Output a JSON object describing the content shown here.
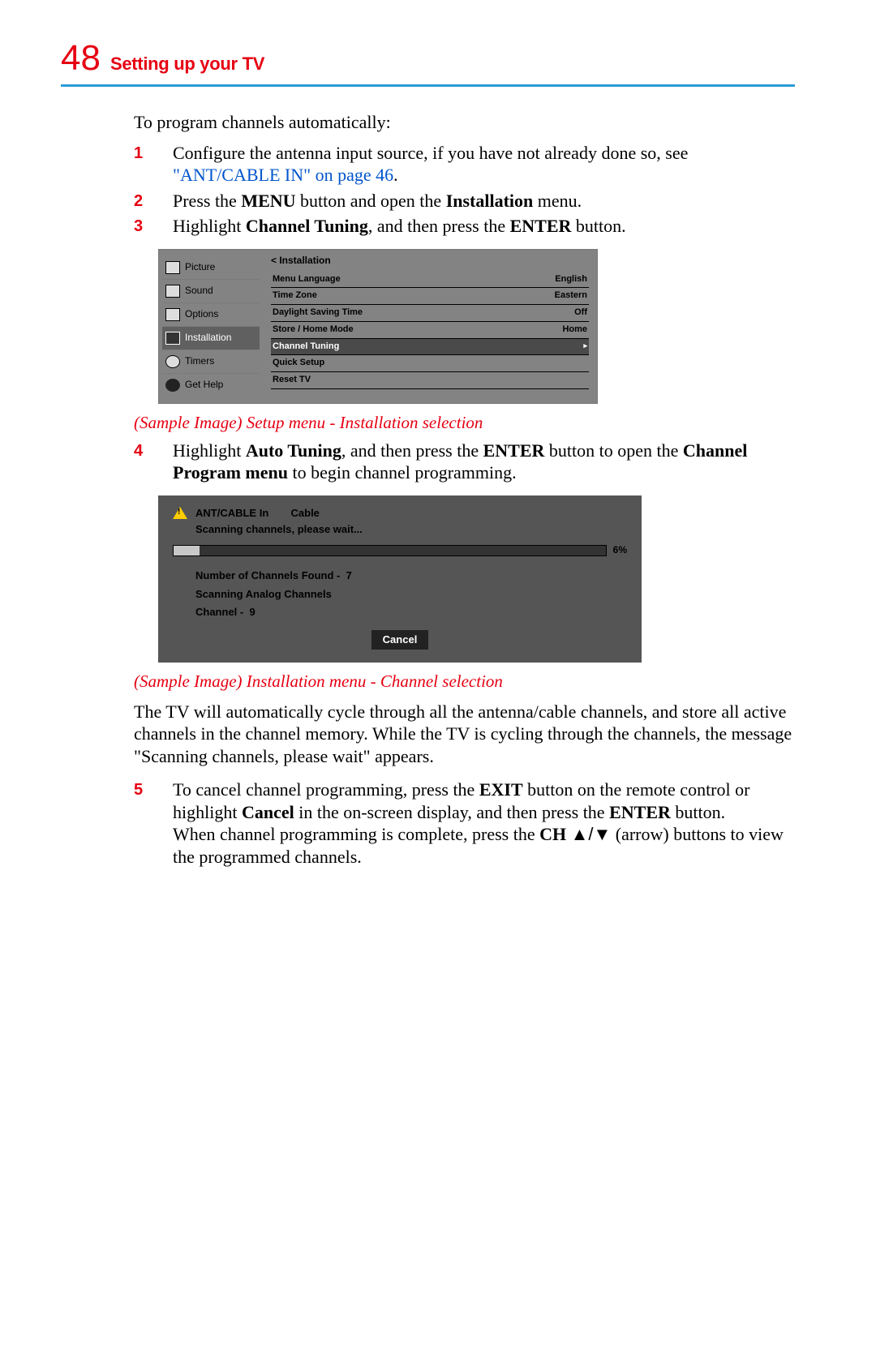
{
  "header": {
    "page_number": "48",
    "chapter": "Setting up your TV"
  },
  "intro": "To program channels automatically:",
  "steps": {
    "s1": {
      "num": "1",
      "t1": "Configure the antenna input source, if you have not already done so, see ",
      "link": "\"ANT/CABLE IN\" on page 46",
      "t2": "."
    },
    "s2": {
      "num": "2",
      "t1": "Press the ",
      "b1": "MENU",
      "t2": " button and open the ",
      "b2": "Installation",
      "t3": " menu."
    },
    "s3": {
      "num": "3",
      "t1": "Highlight ",
      "b1": "Channel Tuning",
      "t2": ", and then press the ",
      "b2": "ENTER",
      "t3": " button."
    },
    "s4": {
      "num": "4",
      "t1": "Highlight ",
      "b1": "Auto Tuning",
      "t2": ", and then press the ",
      "b2": "ENTER",
      "t3": " button to open the ",
      "b3": "Channel Program menu",
      "t4": " to begin channel programming."
    },
    "s5": {
      "num": "5",
      "t1": "To cancel channel programming, press the ",
      "b1": "EXIT",
      "t2": " button on the remote control or highlight ",
      "b2": "Cancel",
      "t3": " in the on-screen display, and then press the ",
      "b3": "ENTER",
      "t4": " button.",
      "cont1": "When channel programming is complete, press the ",
      "b4": "CH",
      "cont2": " (arrow) buttons to view the programmed channels."
    }
  },
  "tvmenu": {
    "title": "<  Installation",
    "sidebar": [
      "Picture",
      "Sound",
      "Options",
      "Installation",
      "Timers",
      "Get Help"
    ],
    "rows": [
      {
        "label": "Menu Language",
        "value": "English"
      },
      {
        "label": "Time Zone",
        "value": "Eastern"
      },
      {
        "label": "Daylight Saving Time",
        "value": "Off"
      },
      {
        "label": "Store / Home Mode",
        "value": "Home"
      },
      {
        "label": "Channel Tuning",
        "value": "▸",
        "selected": true
      },
      {
        "label": "Quick Setup",
        "value": ""
      },
      {
        "label": "Reset TV",
        "value": ""
      }
    ]
  },
  "caption1": "(Sample Image) Setup menu - Installation selection",
  "scan": {
    "head_label": "ANT/CABLE In",
    "head_value": "Cable",
    "wait": "Scanning channels, please wait...",
    "percent": "6%",
    "found_label": "Number of Channels Found  -",
    "found_value": "7",
    "scanning": "Scanning Analog Channels",
    "channel_label": "Channel  -",
    "channel_value": "9",
    "cancel": "Cancel"
  },
  "caption2": "(Sample Image)  Installation menu - Channel selection",
  "after_scan": "The TV will automatically cycle through all the antenna/cable channels, and store all active channels in the channel memory. While the TV is cycling through the channels, the message \"Scanning channels, please wait\" appears.",
  "arrows": "▲/▼"
}
